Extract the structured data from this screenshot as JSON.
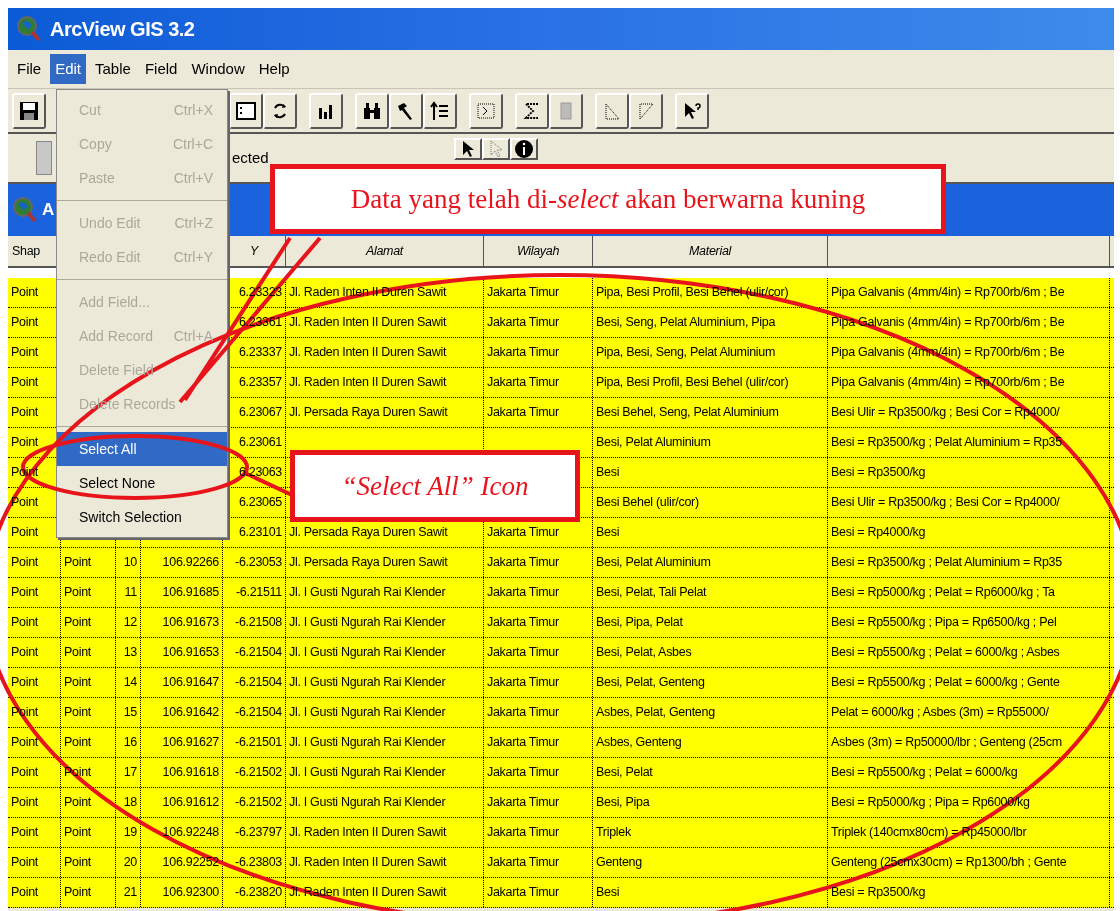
{
  "window": {
    "title": "ArcView GIS 3.2"
  },
  "menu_bar": [
    {
      "label": "File",
      "selected": false
    },
    {
      "label": "Edit",
      "selected": true
    },
    {
      "label": "Table",
      "selected": false
    },
    {
      "label": "Field",
      "selected": false
    },
    {
      "label": "Window",
      "selected": false
    },
    {
      "label": "Help",
      "selected": false
    }
  ],
  "toolbar": [
    [
      {
        "kind": "save"
      }
    ],
    [
      {
        "kind": "form"
      },
      {
        "kind": "refresh"
      }
    ],
    [
      {
        "kind": "chart"
      }
    ],
    [
      {
        "kind": "find"
      },
      {
        "kind": "query"
      },
      {
        "kind": "promote"
      }
    ],
    [
      {
        "kind": "field"
      }
    ],
    [
      {
        "kind": "sigma"
      },
      {
        "kind": "calculate"
      }
    ],
    [
      {
        "kind": "sort_ascending"
      },
      {
        "kind": "sort_descending"
      }
    ],
    [
      {
        "kind": "help"
      }
    ]
  ],
  "status": {
    "text": "ected",
    "tools": [
      {
        "kind": "pointer"
      },
      {
        "kind": "select"
      },
      {
        "kind": "info"
      }
    ]
  },
  "table_window": {
    "title": "A",
    "columns": [
      {
        "label": "Shap"
      },
      {},
      {},
      {},
      {
        "label": "Y"
      },
      {
        "label": "Alamat"
      },
      {
        "label": "Wilayah"
      },
      {
        "label": "Material"
      },
      {}
    ],
    "rows": [
      {
        "cells": [
          "Point",
          null,
          null,
          null,
          "6.23323",
          "Jl. Raden Inten II Duren Sawit",
          "Jakarta Timur",
          "Pipa, Besi Profil, Besi Behel (ulir/cor)",
          "Pipa Galvanis (4mm/4in) = Rp700rb/6m ; Be"
        ]
      },
      {
        "cells": [
          "Point",
          null,
          null,
          null,
          "6.23361",
          "Jl. Raden Inten II Duren Sawit",
          "Jakarta Timur",
          "Besi, Seng, Pelat Aluminium, Pipa",
          "Pipa Galvanis (4mm/4in) = Rp700rb/6m ; Be"
        ]
      },
      {
        "cells": [
          "Point",
          null,
          null,
          null,
          "6.23337",
          "Jl. Raden Inten II Duren Sawit",
          "Jakarta Timur",
          "Pipa, Besi, Seng, Pelat Aluminium",
          "Pipa Galvanis (4mm/4in) = Rp700rb/6m ; Be"
        ]
      },
      {
        "cells": [
          "Point",
          null,
          null,
          null,
          "6.23357",
          "Jl. Raden Inten II Duren Sawit",
          "Jakarta Timur",
          "Pipa, Besi Profil, Besi Behel (ulir/cor)",
          "Pipa Galvanis (4mm/4in) = Rp700rb/6m ; Be"
        ]
      },
      {
        "cells": [
          "Point",
          null,
          null,
          null,
          "6.23067",
          "Jl. Persada Raya Duren Sawit",
          "Jakarta Timur",
          "Besi Behel, Seng, Pelat Aluminium",
          "Besi Ulir = Rp3500/kg ; Besi Cor = Rp4000/"
        ]
      },
      {
        "cells": [
          "Point",
          null,
          null,
          null,
          "6.23061",
          null,
          null,
          "Besi, Pelat Aluminium",
          "Besi = Rp3500/kg ; Pelat Aluminium = Rp35"
        ]
      },
      {
        "cells": [
          "Point",
          null,
          null,
          null,
          "6.23063",
          null,
          null,
          "Besi",
          "Besi = Rp3500/kg"
        ]
      },
      {
        "cells": [
          "Point",
          null,
          null,
          null,
          "6.23065",
          null,
          null,
          "Besi Behel (ulir/cor)",
          "Besi Ulir = Rp3500/kg ; Besi Cor = Rp4000/"
        ]
      },
      {
        "cells": [
          "Point",
          null,
          null,
          null,
          "6.23101",
          "Jl. Persada Raya Duren Sawit",
          "Jakarta Timur",
          "Besi",
          "Besi = Rp4000/kg"
        ]
      },
      {
        "cells": [
          "Point",
          "Point",
          "10",
          "106.92266",
          "-6.23053",
          "Jl. Persada Raya Duren Sawit",
          "Jakarta Timur",
          "Besi, Pelat Aluminium",
          "Besi = Rp3500/kg ; Pelat Aluminium = Rp35"
        ]
      },
      {
        "cells": [
          "Point",
          "Point",
          "11",
          "106.91685",
          "-6.21511",
          "Jl. I Gusti Ngurah Rai Klender",
          "Jakarta Timur",
          "Besi, Pelat, Tali Pelat",
          "Besi = Rp5000/kg ; Pelat = Rp6000/kg ; Ta"
        ]
      },
      {
        "cells": [
          "Point",
          "Point",
          "12",
          "106.91673",
          "-6.21508",
          "Jl. I Gusti Ngurah Rai Klender",
          "Jakarta Timur",
          "Besi, Pipa, Pelat",
          "Besi = Rp5500/kg ; Pipa = Rp6500/kg ; Pel"
        ]
      },
      {
        "cells": [
          "Point",
          "Point",
          "13",
          "106.91653",
          "-6.21504",
          "Jl. I Gusti Ngurah Rai Klender",
          "Jakarta Timur",
          "Besi, Pelat, Asbes",
          "Besi = Rp5500/kg ; Pelat = 6000/kg ; Asbes"
        ]
      },
      {
        "cells": [
          "Point",
          "Point",
          "14",
          "106.91647",
          "-6.21504",
          "Jl. I Gusti Ngurah Rai Klender",
          "Jakarta Timur",
          "Besi, Pelat, Genteng",
          "Besi = Rp5500/kg ; Pelat = 6000/kg ; Gente"
        ]
      },
      {
        "cells": [
          "Point",
          "Point",
          "15",
          "106.91642",
          "-6.21504",
          "Jl. I Gusti Ngurah Rai Klender",
          "Jakarta Timur",
          "Asbes, Pelat, Genteng",
          "Pelat = 6000/kg ; Asbes (3m) = Rp55000/"
        ]
      },
      {
        "cells": [
          "Point",
          "Point",
          "16",
          "106.91627",
          "-6.21501",
          "Jl. I Gusti Ngurah Rai Klender",
          "Jakarta Timur",
          "Asbes, Genteng",
          "Asbes (3m) = Rp50000/lbr ; Genteng (25cm"
        ]
      },
      {
        "cells": [
          "Point",
          "Point",
          "17",
          "106.91618",
          "-6.21502",
          "Jl. I Gusti Ngurah Rai Klender",
          "Jakarta Timur",
          "Besi, Pelat",
          "Besi = Rp5500/kg ; Pelat = 6000/kg"
        ]
      },
      {
        "cells": [
          "Point",
          "Point",
          "18",
          "106.91612",
          "-6.21502",
          "Jl. I Gusti Ngurah Rai Klender",
          "Jakarta Timur",
          "Besi, Pipa",
          "Besi = Rp5000/kg ; Pipa = Rp6000/kg"
        ]
      },
      {
        "cells": [
          "Point",
          "Point",
          "19",
          "106.92248",
          "-6.23797",
          "Jl. Raden Inten II Duren Sawit",
          "Jakarta Timur",
          "Triplek",
          "Triplek (140cmx80cm) = Rp45000/lbr"
        ]
      },
      {
        "cells": [
          "Point",
          "Point",
          "20",
          "106.92252",
          "-6.23803",
          "Jl. Raden Inten II Duren Sawit",
          "Jakarta Timur",
          "Genteng",
          "Genteng (25cmx30cm) = Rp1300/bh ; Gente"
        ]
      },
      {
        "cells": [
          "Point",
          "Point",
          "21",
          "106.92300",
          "-6.23820",
          "Jl. Raden Inten II Duren Sawit",
          "Jakarta Timur",
          "Besi",
          "Besi = Rp3500/kg"
        ]
      }
    ]
  },
  "edit_menu": [
    {
      "kind": "item",
      "label": "Cut",
      "shortcut": "Ctrl+X",
      "disabled": true,
      "selected": false
    },
    {
      "kind": "item",
      "label": "Copy",
      "shortcut": "Ctrl+C",
      "disabled": true,
      "selected": false
    },
    {
      "kind": "item",
      "label": "Paste",
      "shortcut": "Ctrl+V",
      "disabled": true,
      "selected": false
    },
    {
      "kind": "separator"
    },
    {
      "kind": "item",
      "label": "Undo Edit",
      "shortcut": "Ctrl+Z",
      "disabled": true,
      "selected": false
    },
    {
      "kind": "item",
      "label": "Redo Edit",
      "shortcut": "Ctrl+Y",
      "disabled": true,
      "selected": false
    },
    {
      "kind": "separator"
    },
    {
      "kind": "item",
      "label": "Add Field...",
      "disabled": true,
      "selected": false
    },
    {
      "kind": "item",
      "label": "Add Record",
      "shortcut": "Ctrl+A",
      "disabled": true,
      "selected": false
    },
    {
      "kind": "item",
      "label": "Delete Field",
      "disabled": true,
      "selected": false
    },
    {
      "kind": "item",
      "label": "Delete Records",
      "disabled": true,
      "selected": false
    },
    {
      "kind": "separator"
    },
    {
      "kind": "item",
      "label": "Select All",
      "disabled": false,
      "selected": true
    },
    {
      "kind": "item",
      "label": "Select None",
      "disabled": false,
      "selected": false
    },
    {
      "kind": "item",
      "label": "Switch Selection",
      "disabled": false,
      "selected": false
    }
  ],
  "annotations": [
    {
      "kind": "callout",
      "text": "Data yang telah di-*select* akan berwarna kuning",
      "italic": false
    },
    {
      "kind": "callout",
      "text": "“Select All” Icon",
      "italic": true
    }
  ]
}
